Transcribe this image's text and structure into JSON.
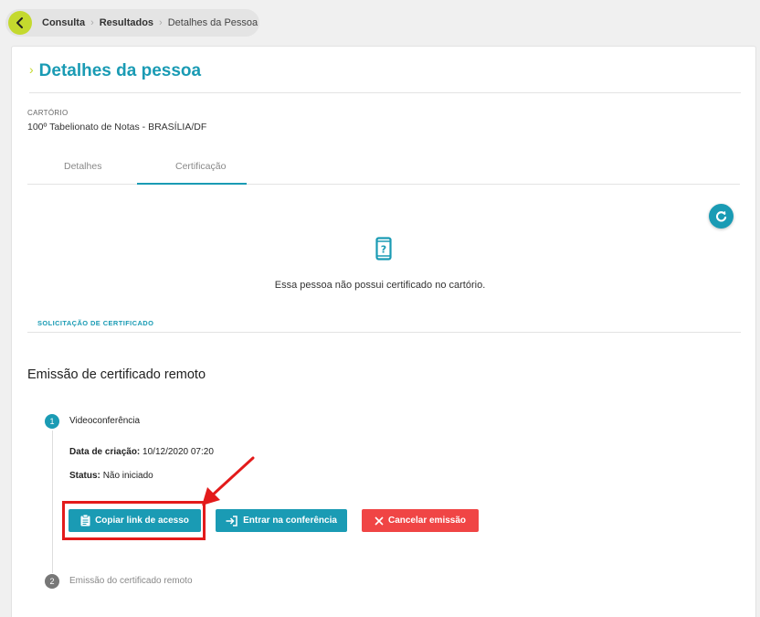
{
  "breadcrumb": {
    "items": [
      "Consulta",
      "Resultados",
      "Detalhes da Pessoa"
    ]
  },
  "page": {
    "title": "Detalhes da pessoa"
  },
  "cartorio": {
    "label": "CARTÓRIO",
    "value": "100º Tabelionato de Notas - BRASÍLIA/DF"
  },
  "tabs": [
    {
      "label": "Detalhes",
      "active": false
    },
    {
      "label": "Certificação",
      "active": true
    }
  ],
  "certificacao": {
    "empty_message": "Essa pessoa não possui certificado no cartório.",
    "section_label": "SOLICITAÇÃO DE CERTIFICADO",
    "emissao_title": "Emissão de certificado remoto",
    "steps": [
      {
        "number": "1",
        "label": "Videoconferência",
        "data_criacao_label": "Data de criação:",
        "data_criacao_value": "10/12/2020 07:20",
        "status_label": "Status:",
        "status_value": "Não iniciado"
      },
      {
        "number": "2",
        "label": "Emissão do certificado remoto"
      }
    ],
    "buttons": {
      "copy_link": "Copiar link de acesso",
      "enter_conference": "Entrar na conferência",
      "cancel": "Cancelar emissão"
    }
  },
  "icons": {
    "back": "chevron-left-icon",
    "refresh": "refresh-icon",
    "phone": "phone-question-icon",
    "clipboard": "clipboard-icon",
    "enter": "sign-in-icon",
    "cancel": "close-icon"
  },
  "colors": {
    "primary": "#1a9bb4",
    "accent": "#c4d92e",
    "danger": "#f04545",
    "annotation": "#e31b1b"
  }
}
